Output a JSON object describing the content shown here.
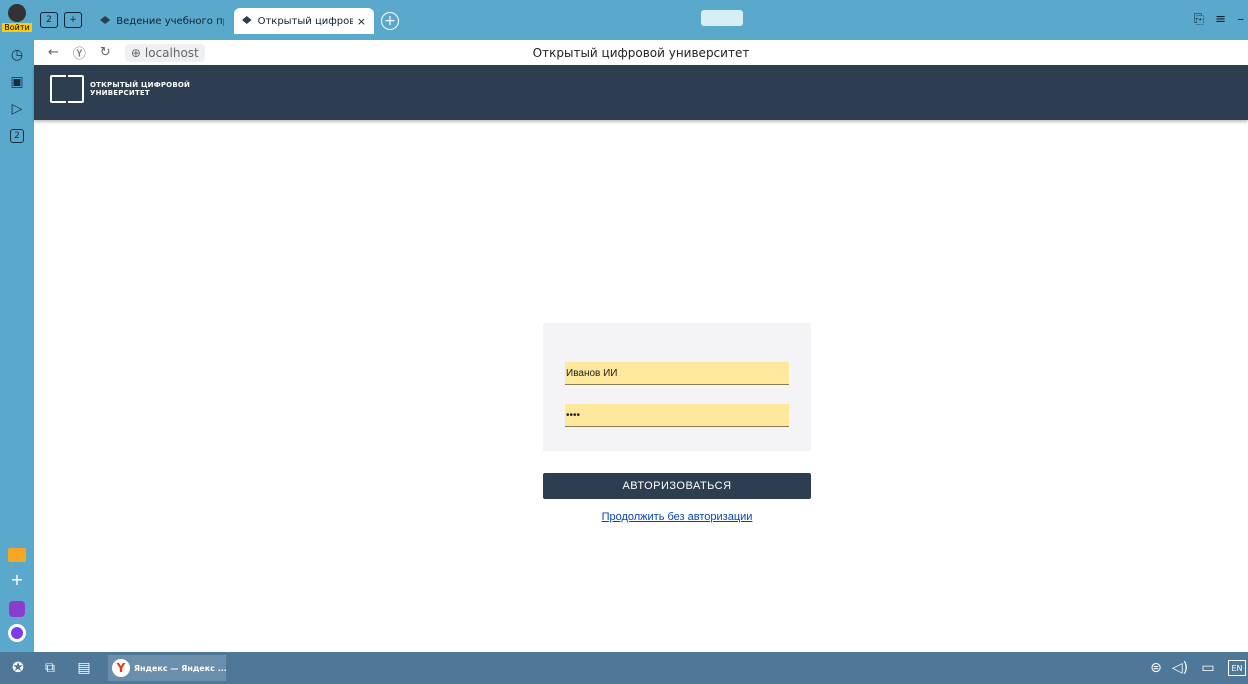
{
  "browser": {
    "login_label": "Войти",
    "tabs_count_badge": "2",
    "sidebar_counter": "2",
    "tabs": [
      {
        "label": "Ведение учебного проц"
      },
      {
        "label": "Открытый цифровой у",
        "close": "×",
        "active": true
      }
    ],
    "new_tab_label": "+",
    "address": "localhost",
    "page_title": "Открытый цифровой университет",
    "icons": [
      "back-icon",
      "yandex-icon",
      "reload-icon",
      "globe-icon",
      "bookmark-icon",
      "menu-icon",
      "minimize-icon"
    ]
  },
  "site": {
    "logo_line1": "ОТКРЫТЫЙ ЦИФРОВОЙ",
    "logo_line2": "УНИВЕРСИТЕТ",
    "header_color": "#2c3e50"
  },
  "login_form": {
    "login_value": "Иванов ИИ",
    "password_value": "••••",
    "submit_label": "АВТОРИЗОВАТЬСЯ",
    "skip_link": "Продолжить без авторизации",
    "autofill_color": "#fde89b"
  },
  "taskbar": {
    "task_label": "Яндекс — Яндекс ...",
    "lang": "EN"
  }
}
